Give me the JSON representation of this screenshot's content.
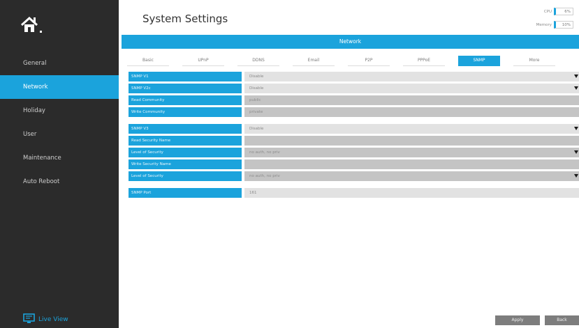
{
  "sidebar": {
    "items": [
      {
        "label": "General"
      },
      {
        "label": "Network"
      },
      {
        "label": "Holiday"
      },
      {
        "label": "User"
      },
      {
        "label": "Maintenance"
      },
      {
        "label": "Auto Reboot"
      }
    ],
    "live_view_label": "Live View"
  },
  "header": {
    "title": "System Settings",
    "cpu_label": "CPU",
    "cpu_value": "6%",
    "memory_label": "Memory",
    "memory_value": "10%"
  },
  "banner": {
    "title": "Network"
  },
  "tabs": [
    {
      "label": "Basic"
    },
    {
      "label": "UPnP"
    },
    {
      "label": "DDNS"
    },
    {
      "label": "Email"
    },
    {
      "label": "P2P"
    },
    {
      "label": "PPPoE"
    },
    {
      "label": "SNMP"
    },
    {
      "label": "More"
    }
  ],
  "form": {
    "snmp_v1": {
      "label": "SNMP V1",
      "value": "Disable"
    },
    "snmp_v2c": {
      "label": "SNMP V2c",
      "value": "Disable"
    },
    "read_community": {
      "label": "Read Community",
      "value": "public"
    },
    "write_community": {
      "label": "Write Community",
      "value": "private"
    },
    "snmp_v3": {
      "label": "SNMP V3",
      "value": "Disable"
    },
    "read_security_name": {
      "label": "Read Security Name",
      "value": ""
    },
    "read_level_of_security": {
      "label": "Level of Security",
      "value": "no auth, no priv"
    },
    "write_security_name": {
      "label": "Write Security Name",
      "value": ""
    },
    "write_level_of_security": {
      "label": "Level of Security",
      "value": "no auth, no priv"
    },
    "snmp_port": {
      "label": "SNMP Port",
      "value": "161"
    }
  },
  "buttons": {
    "apply": "Apply",
    "back": "Back"
  },
  "colors": {
    "accent": "#1ba3dc",
    "sidebar": "#2b2b2b"
  }
}
